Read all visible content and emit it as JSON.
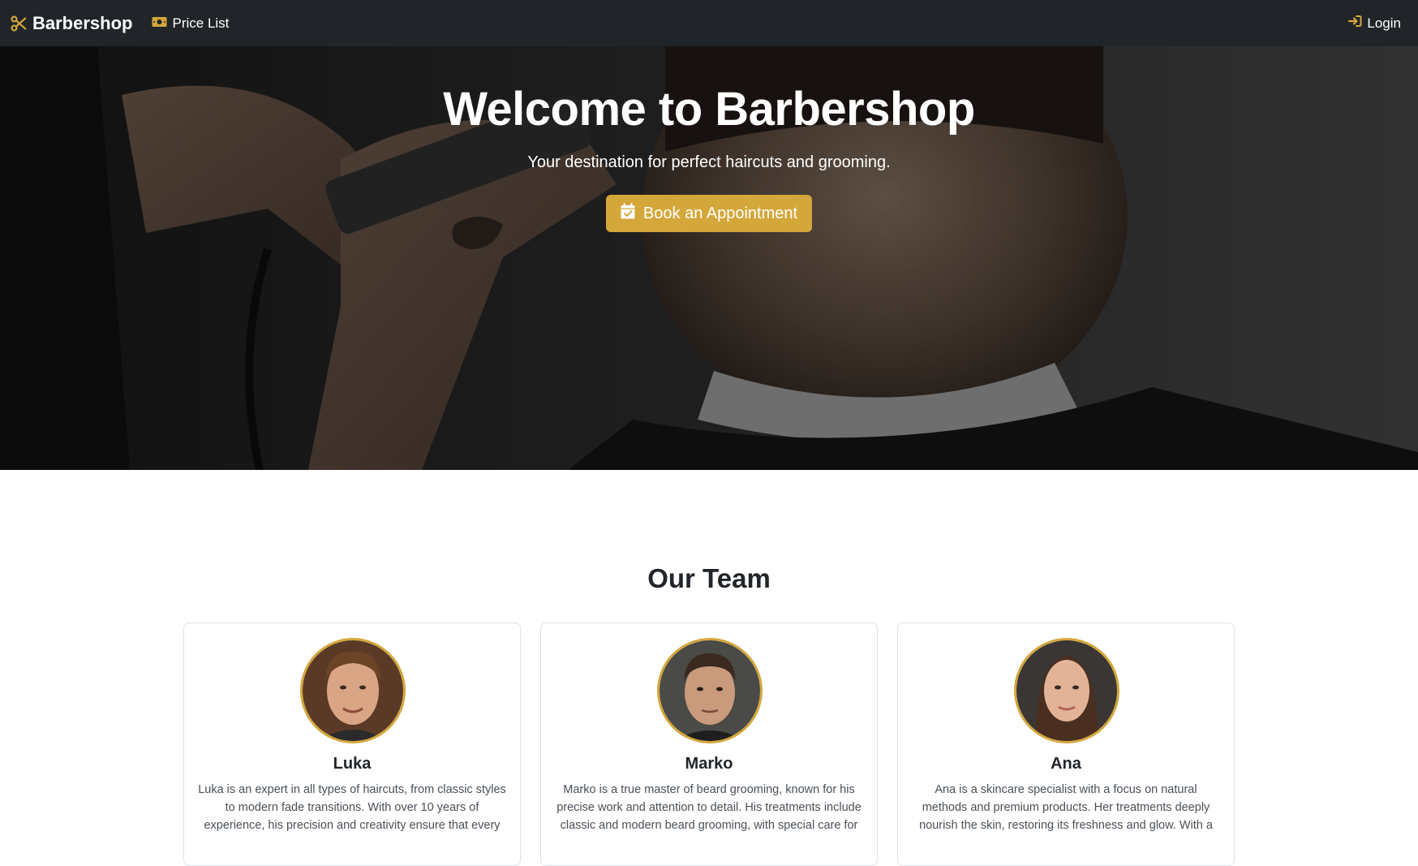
{
  "navbar": {
    "brand": "Barbershop",
    "price_list": "Price List",
    "login": "Login",
    "accent_color": "#d4a73b",
    "background": "#212529"
  },
  "hero": {
    "title": "Welcome to Barbershop",
    "subtitle": "Your destination for perfect haircuts and grooming.",
    "book_button": "Book an Appointment",
    "button_color": "#d4a73b"
  },
  "team": {
    "title": "Our Team",
    "members": [
      {
        "name": "Luka",
        "bio": "Luka is an expert in all types of haircuts, from classic styles to modern fade transitions. With over 10 years of experience, his precision and creativity ensure that every"
      },
      {
        "name": "Marko",
        "bio": "Marko is a true master of beard grooming, known for his precise work and attention to detail. His treatments include classic and modern beard grooming, with special care for"
      },
      {
        "name": "Ana",
        "bio": "Ana is a skincare specialist with a focus on natural methods and premium products. Her treatments deeply nourish the skin, restoring its freshness and glow. With a"
      }
    ]
  }
}
